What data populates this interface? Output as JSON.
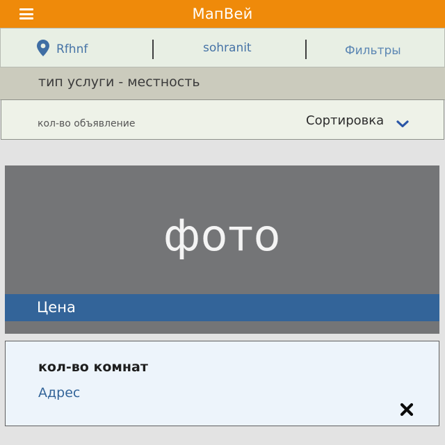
{
  "header": {
    "title": "МапВей",
    "menu_icon": "hamburger-menu-icon",
    "background_color": "#ef8a0a"
  },
  "nav": {
    "location_label": "Rfhnf",
    "location_icon": "map-pin-icon",
    "saved_label": "sohranit",
    "filters_label": "Фильтры",
    "accent_color": "#4673a6"
  },
  "category": {
    "text": "тип услуги - местность"
  },
  "sort_bar": {
    "count_label": "кол-во объявление",
    "sort_label": "Сортировка",
    "dropdown_icon": "chevron-down-icon"
  },
  "listing": {
    "photo_placeholder": "фото",
    "price_label": "Цена",
    "rooms_label": "кол-во комнат",
    "address_label": "Адрес",
    "close_icon": "close-icon",
    "price_strip_color": "#336499"
  }
}
